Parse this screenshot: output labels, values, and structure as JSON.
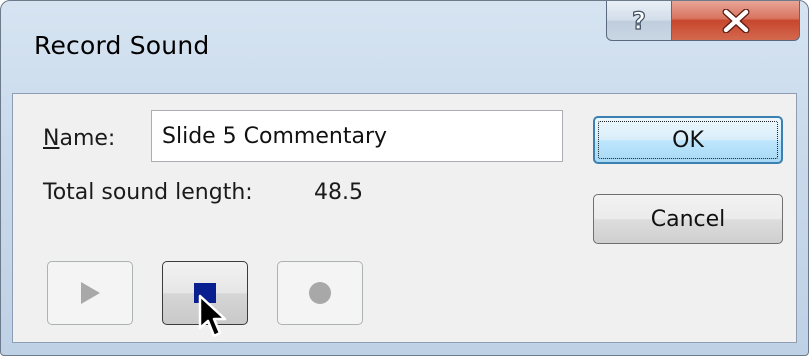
{
  "window": {
    "title": "Record Sound",
    "help_glyph": "?",
    "close_icon": "close-x-icon"
  },
  "form": {
    "name_label_accesskey": "N",
    "name_label_rest": "ame:",
    "name_value": "Slide 5 Commentary",
    "length_label": "Total sound length:",
    "length_value": "48.5"
  },
  "buttons": {
    "ok": "OK",
    "cancel": "Cancel"
  },
  "media_controls": [
    {
      "name": "play",
      "icon": "play-triangle-icon",
      "enabled": false
    },
    {
      "name": "stop",
      "icon": "stop-square-icon",
      "enabled": true
    },
    {
      "name": "record",
      "icon": "record-circle-icon",
      "enabled": false
    }
  ],
  "colors": {
    "stop_square": "#0a1f8f",
    "disabled_glyph": "#a8a8a8",
    "close_button": "#c7462c",
    "ok_border": "#3c7fb1"
  }
}
